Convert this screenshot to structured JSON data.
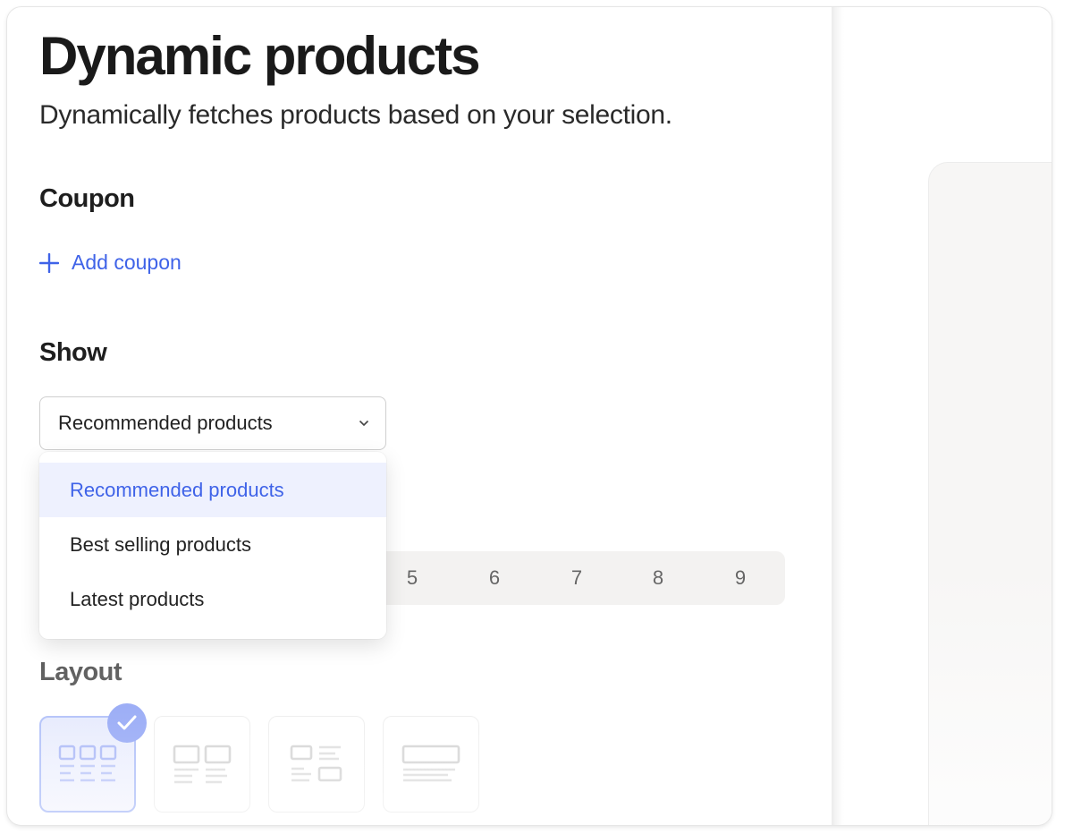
{
  "header": {
    "title": "Dynamic products",
    "subtitle": "Dynamically fetches products based on your selection."
  },
  "coupon": {
    "heading": "Coupon",
    "add_label": "Add coupon",
    "icon": "plus-icon"
  },
  "show": {
    "heading": "Show",
    "selected": "Recommended products",
    "options": [
      "Recommended products",
      "Best selling products",
      "Latest products"
    ]
  },
  "count": {
    "options": [
      "5",
      "6",
      "7",
      "8",
      "9"
    ]
  },
  "layout": {
    "heading": "Layout",
    "selected_index": 0,
    "options": [
      "grid-3-icon",
      "grid-2-icon",
      "list-alternating-icon",
      "banner-icon"
    ]
  },
  "colors": {
    "accent": "#3f63e8",
    "selected_bg": "#eef1fe",
    "check": "#8ea2f5"
  }
}
